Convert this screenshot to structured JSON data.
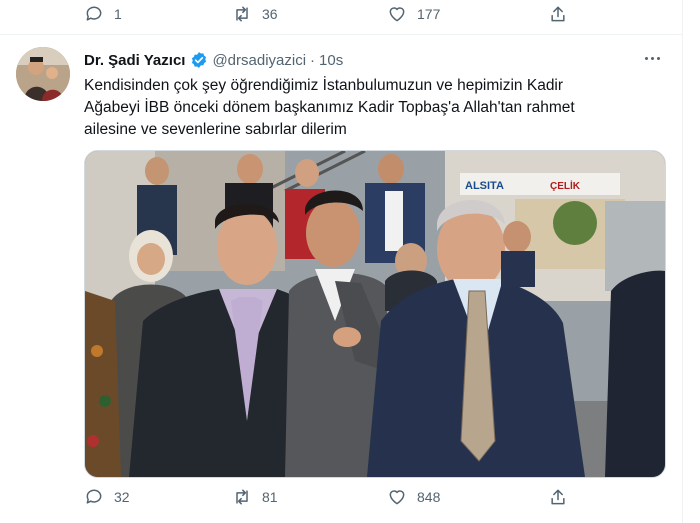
{
  "previous_tweet": {
    "reply_count": "1",
    "retweet_count": "36",
    "like_count": "177"
  },
  "tweet": {
    "author_name": "Dr. Şadi Yazıcı",
    "handle": "@drsadiyazici",
    "separator": "·",
    "time": "10s",
    "text_lines": [
      "Kendisinden çok şey öğrendiğimiz İstanbulumuzun ve hepimizin Kadir",
      "Ağabeyi İBB önceki dönem başkanımız Kadir Topbaş'a Allah'tan rahmet",
      "ailesine ve sevenlerine sabırlar dilerim"
    ],
    "reply_count": "32",
    "retweet_count": "81",
    "like_count": "848"
  },
  "photo": {
    "signs": [
      "ALSITA",
      "ÇELİK"
    ]
  },
  "icons": {
    "reply": "reply-icon",
    "retweet": "retweet-icon",
    "like": "heart-icon",
    "share": "share-icon",
    "verified": "verified-badge-icon",
    "more": "more-options-icon"
  },
  "colors": {
    "text_primary": "#0f1419",
    "text_secondary": "#536471",
    "verified_blue": "#1d9bf0",
    "divider": "#eff3f4"
  }
}
